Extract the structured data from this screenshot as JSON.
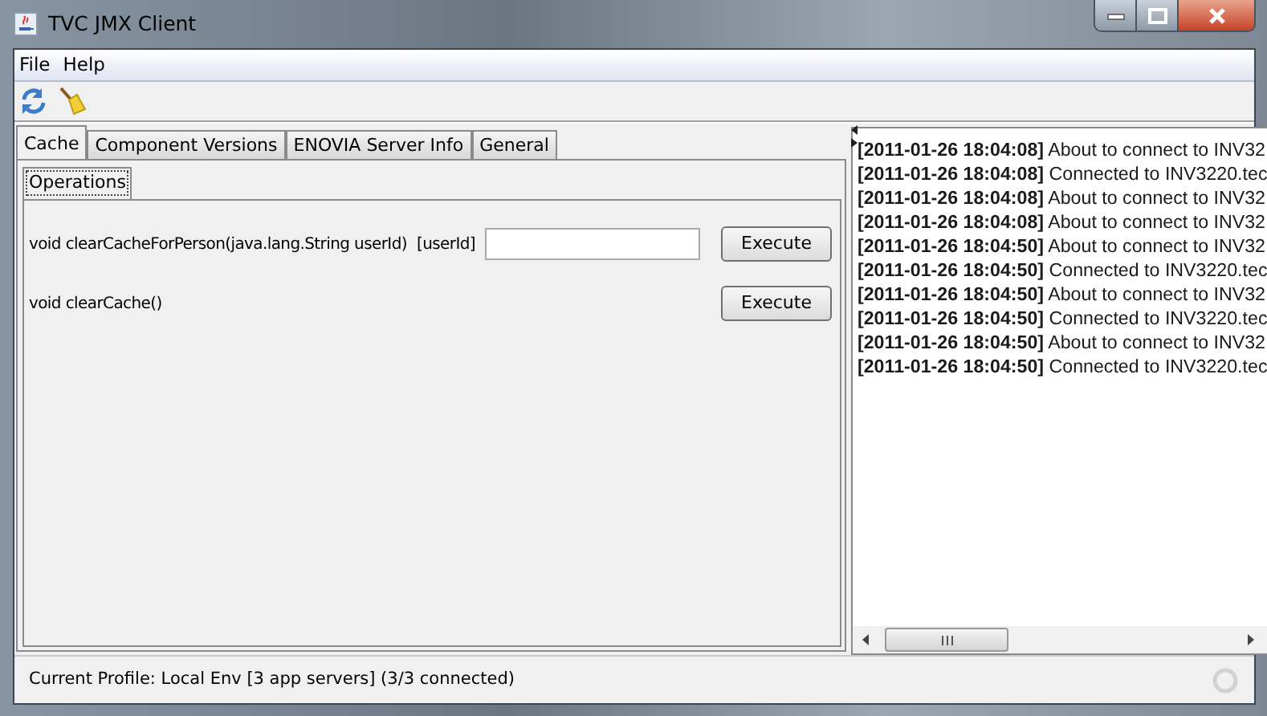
{
  "window": {
    "title": "TVC JMX Client"
  },
  "menu": [
    {
      "label": "File"
    },
    {
      "label": "Help"
    }
  ],
  "toolbar": [
    {
      "kind": "refresh"
    },
    {
      "kind": "broom"
    }
  ],
  "tabs": [
    {
      "label": "Cache",
      "selected": true
    },
    {
      "label": "Component Versions",
      "selected": false
    },
    {
      "label": "ENOVIA Server Info",
      "selected": false
    },
    {
      "label": "General",
      "selected": false
    }
  ],
  "subtabs": [
    {
      "label": "Operations",
      "selected": true
    }
  ],
  "operations": [
    {
      "signature": "void clearCacheForPerson(java.lang.String userId)",
      "parameter": {
        "label": "[userId]"
      },
      "button": "Execute"
    },
    {
      "signature": "void clearCache()",
      "button": "Execute"
    }
  ],
  "log": [
    {
      "time": "[2011-01-26 18:04:08]",
      "message": "About to connect to INV32"
    },
    {
      "time": "[2011-01-26 18:04:08]",
      "message": "Connected to INV3220.tec"
    },
    {
      "time": "[2011-01-26 18:04:08]",
      "message": "About to connect to INV32"
    },
    {
      "time": "[2011-01-26 18:04:08]",
      "message": "About to connect to INV32"
    },
    {
      "time": "[2011-01-26 18:04:50]",
      "message": "About to connect to INV32"
    },
    {
      "time": "[2011-01-26 18:04:50]",
      "message": "Connected to INV3220.tec"
    },
    {
      "time": "[2011-01-26 18:04:50]",
      "message": "About to connect to INV32"
    },
    {
      "time": "[2011-01-26 18:04:50]",
      "message": "Connected to INV3220.tec"
    },
    {
      "time": "[2011-01-26 18:04:50]",
      "message": "About to connect to INV32"
    },
    {
      "time": "[2011-01-26 18:04:50]",
      "message": "Connected to INV3220.tec"
    }
  ],
  "status_bar": {
    "text": "Current Profile: Local Env [3 app servers] (3/3 connected)"
  }
}
